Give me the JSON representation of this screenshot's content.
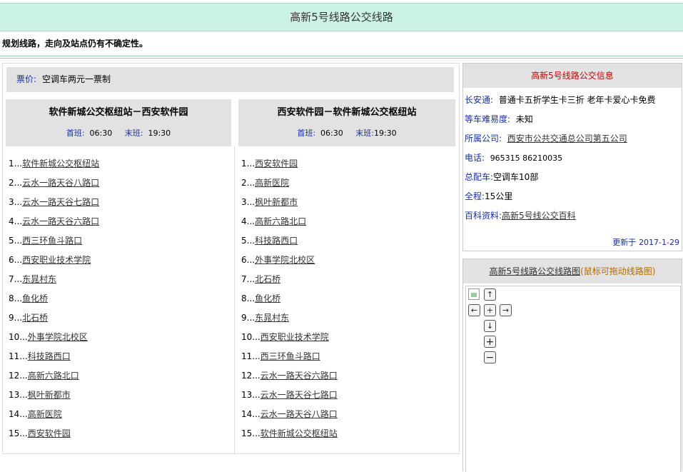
{
  "page_title": "高新5号线路公交线路",
  "notice": "规划线路，走向及站点仍有不确定性。",
  "fare": {
    "label": "票价:",
    "value": "空调车两元一票制"
  },
  "routes": [
    {
      "name": "软件新城公交枢纽站－西安软件园",
      "first_label": "首班:",
      "first_time": "06:30",
      "last_label": "末班:",
      "last_time": "19:30",
      "stops": [
        {
          "num": "1...",
          "name": "软件新城公交枢纽站"
        },
        {
          "num": "2...",
          "name": "云水一路天谷八路口"
        },
        {
          "num": "3...",
          "name": "云水一路天谷七路口"
        },
        {
          "num": "4...",
          "name": "云水一路天谷六路口"
        },
        {
          "num": "5...",
          "name": "西三环鱼斗路口"
        },
        {
          "num": "6...",
          "name": "西安职业技术学院"
        },
        {
          "num": "7...",
          "name": "东晁村东"
        },
        {
          "num": "8...",
          "name": "鱼化桥"
        },
        {
          "num": "9...",
          "name": "北石桥"
        },
        {
          "num": "10...",
          "name": "外事学院北校区"
        },
        {
          "num": "11...",
          "name": "科技路西口"
        },
        {
          "num": "12...",
          "name": "高新六路北口"
        },
        {
          "num": "13...",
          "name": "枫叶新都市"
        },
        {
          "num": "14...",
          "name": "高新医院"
        },
        {
          "num": "15...",
          "name": "西安软件园"
        }
      ]
    },
    {
      "name": "西安软件园－软件新城公交枢纽站",
      "first_label": "首班:",
      "first_time": "06:30",
      "last_label": "末班:",
      "last_time": "19:30",
      "stops": [
        {
          "num": "1...",
          "name": "西安软件园"
        },
        {
          "num": "2...",
          "name": "高新医院"
        },
        {
          "num": "3...",
          "name": "枫叶新都市"
        },
        {
          "num": "4...",
          "name": "高新六路北口"
        },
        {
          "num": "5...",
          "name": "科技路西口"
        },
        {
          "num": "6...",
          "name": "外事学院北校区"
        },
        {
          "num": "7...",
          "name": "北石桥"
        },
        {
          "num": "8...",
          "name": "鱼化桥"
        },
        {
          "num": "9...",
          "name": "东晁村东"
        },
        {
          "num": "10...",
          "name": "西安职业技术学院"
        },
        {
          "num": "11...",
          "name": "西三环鱼斗路口"
        },
        {
          "num": "12...",
          "name": "云水一路天谷六路口"
        },
        {
          "num": "13...",
          "name": "云水一路天谷七路口"
        },
        {
          "num": "14...",
          "name": "云水一路天谷八路口"
        },
        {
          "num": "15...",
          "name": "软件新城公交枢纽站"
        }
      ]
    }
  ],
  "info": {
    "title": "高新5号线路公交信息",
    "card_label": "长安通:",
    "card_value": "普通卡五折学生卡三折 老年卡爱心卡免费",
    "difficulty_label": "等车难易度:",
    "difficulty_value": "未知",
    "company_label": "所属公司:",
    "company_value": "西安市公共交通总公司第五公司",
    "phone_label": "电话:",
    "phone_value": "965315 86210035",
    "vehicles_label": "总配车:",
    "vehicles_value": "空调车10部",
    "length_label": "全程:",
    "length_value": "15公里",
    "wiki_label": "百科资料:",
    "wiki_value": "高新5号线公交百科",
    "updated_label": "更新于",
    "updated_value": "2017-1-29"
  },
  "map": {
    "title_link": "高新5号线路公交线路图",
    "hint": "(鼠标可拖动线路图)",
    "controls": {
      "up": "↑",
      "left": "←",
      "center": "+",
      "right": "→",
      "down": "↓",
      "zoom_in": "+",
      "zoom_out": "−"
    }
  }
}
